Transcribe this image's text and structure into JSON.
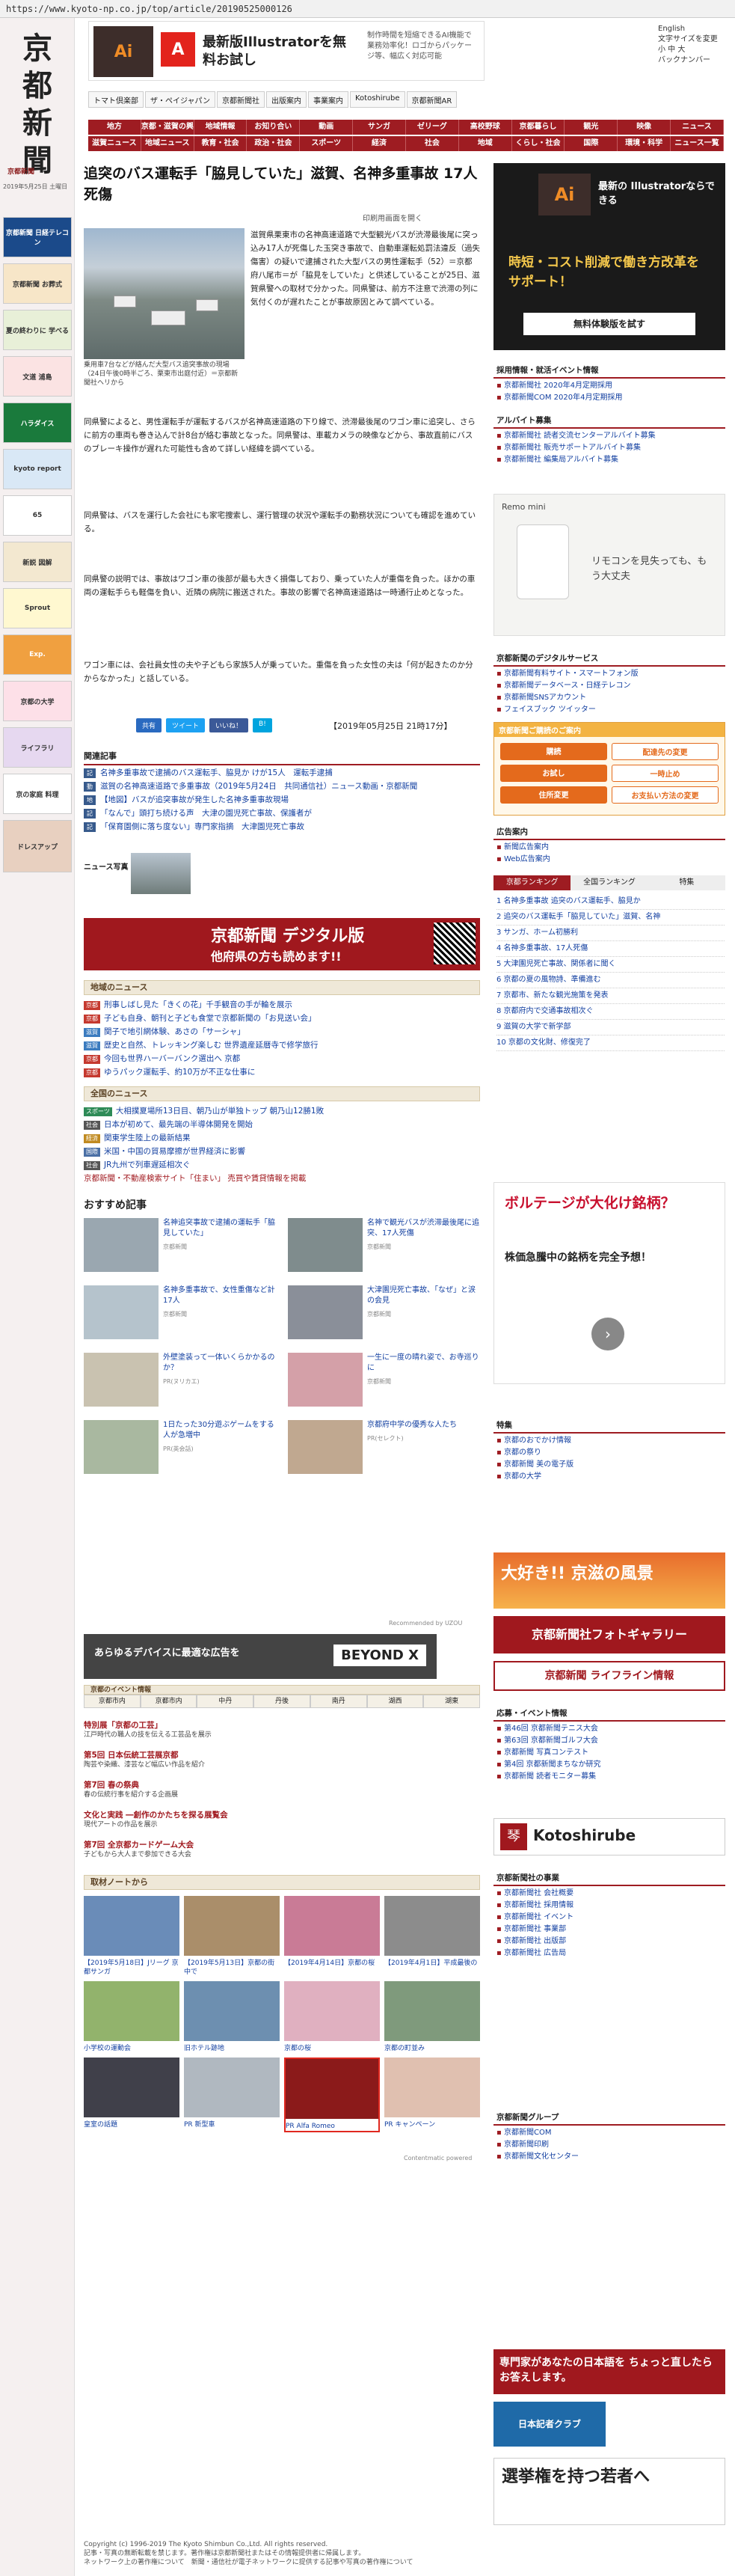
{
  "browser": {
    "url": "https://www.kyoto-np.co.jp/top/article/20190525000126"
  },
  "site": {
    "logo_lines": [
      "京",
      "都",
      "新",
      "聞"
    ],
    "name": "京都新聞",
    "date_text": "2019年5月25日 土曜日"
  },
  "left_banners": [
    "京都新聞 日経テレコン",
    "京都新聞 お葬式",
    "夏の終わりに 学べる",
    "文道 浦島",
    "ハラダイス",
    "kyoto report",
    "65",
    "新説 図解",
    "Sprout",
    "Exp.",
    "京都の大学",
    "ライフラリ",
    "京の家庭 料理",
    "ドレスアップ"
  ],
  "top_ad": {
    "left_label": "Ai",
    "adobe": "A",
    "headline": "最新版Illustratorを無料お試し",
    "body": "制作時間を短縮できるAI機能で業務効率化！ロゴからパッケージ等、幅広く対応可能"
  },
  "english": {
    "line1": "English",
    "line2": "文字サイズを変更",
    "line3": "小 中 大",
    "line4": "バックナンバー"
  },
  "toolbar": [
    "トマト倶楽部",
    "ザ・ペイジャパン",
    "京都新聞社",
    "出版案内",
    "事業案内",
    "Kotoshirube",
    "京都新聞AR"
  ],
  "nav1": [
    "地方",
    "京都・滋賀の興味",
    "地域情報",
    "お知り合い",
    "動画",
    "サンガ",
    "ゼリーグ",
    "高校野球",
    "京都暮らし",
    "観光",
    "映像",
    "ニュース"
  ],
  "nav2": [
    "滋賀ニュース",
    "地域ニュース",
    "教育・社会",
    "政治・社会",
    "スポーツ",
    "経済",
    "社会",
    "地域",
    "くらし・社会",
    "国際",
    "環境・科学",
    "ニュース一覧"
  ],
  "article": {
    "title": "追突のバス運転手「脇見していた」滋賀、名神多重事故 17人死傷",
    "meta": "印刷用画面を開く",
    "caption": "乗用車7台などが絡んだ大型バス追突事故の現場（24日午後0時半ごろ、栗東市出庭付近）＝京都新聞社ヘリから",
    "p1": "滋賀県栗東市の名神高速道路で大型観光バスが渋滞最後尾に突っ込み17人が死傷した玉突き事故で、自動車運転処罰法違反（過失傷害）の疑いで逮捕された大型バスの男性運転手（52）＝京都府八尾市＝が「脇見をしていた」と供述していることが25日、滋賀県警への取材で分かった。同県警は、前方不注意で渋滞の列に気付くのが遅れたことが事故原因とみて調べている。",
    "p2": "同県警によると、男性運転手が運転するバスが名神高速道路の下り線で、渋滞最後尾のワゴン車に追突し、さらに前方の車両も巻き込んで計8台が絡む事故となった。同県警は、車載カメラの映像などから、事故直前にバスのブレーキ操作が遅れた可能性も含めて詳しい経緯を調べている。",
    "p3": "同県警は、バスを運行した会社にも家宅捜索し、運行管理の状況や運転手の勤務状況についても確認を進めている。",
    "p4": "同県警の説明では、事故はワゴン車の後部が最も大きく損傷しており、乗っていた人が重傷を負った。ほかの車両の運転手らも軽傷を負い、近隣の病院に搬送された。事故の影響で名神高速道路は一時通行止めとなった。",
    "p5": "ワゴン車には、会社員女性の夫や子どもら家族5人が乗っていた。重傷を負った女性の夫は「何が起きたのか分からなかった」と話している。",
    "date": "【2019年05月25日 21時17分】"
  },
  "sns": [
    "共有",
    "ツイート",
    "いいね！",
    "B!"
  ],
  "related": {
    "heading": "関連記事",
    "items": [
      "名神多重事故で逮捕のバス運転手、脇見か けが15人　運転手逮捕",
      "滋賀の名神高速道路で多重事故（2019年5月24日　共同通信社）ニュース動画・京都新聞",
      "【地図】バスが追突事故が発生した名神多重事故現場",
      "「なんで」頭打ち続ける声　大津の園児死亡事故、保護者が",
      "「保育園側に落ち度ない」専門家指摘　大津園児死亡事故"
    ]
  },
  "news_photo_label": "ニュース写真",
  "digital_banner": {
    "title": "京都新聞 デジタル版",
    "subtitle": "他府県の方も読めます!!"
  },
  "local_news": {
    "heading": "地域のニュース",
    "items": [
      [
        "京都",
        "刑事しばし見た「きくの花」千手観音の手が輪を展示"
      ],
      [
        "京都",
        "子ども自身、朝刊と子ども食堂で京都新聞の「お見送い会」"
      ],
      [
        "滋賀",
        "関子で地引網体験、あさの「サーシャ」"
      ],
      [
        "滋賀",
        "歴史と自然、トレッキング楽しむ 世界遺産延暦寺で修学旅行"
      ],
      [
        "京都",
        "今回も世界ハーバーバンク選出へ 京都"
      ],
      [
        "京都",
        "ゆうパック運転手、約10万が不正な仕事に"
      ]
    ]
  },
  "national_news": {
    "heading": "全国のニュース",
    "items": [
      [
        "スポーツ",
        "大相撲夏場所13日目、朝乃山が単独トップ 朝乃山12勝1敗"
      ],
      [
        "社会",
        "日本が初めて、最先端の半導体開発を開始"
      ],
      [
        "経済",
        "関東学生陸上の最新結果"
      ],
      [
        "国際",
        "米国・中国の貿易摩擦が世界経済に影響"
      ],
      [
        "社会",
        "JR九州で列車遅延相次ぐ"
      ]
    ],
    "notice": "京都新聞・不動産検索サイト「住まい」 売買や賃貸情報を掲載"
  },
  "recommend": {
    "heading": "おすすめ記事",
    "items": [
      {
        "t": "名神追突事故で逮捕の運転手「脇見していた」",
        "src": "京都新聞"
      },
      {
        "t": "名神で観光バスが渋滞最後尾に追突、17人死傷",
        "src": "京都新聞"
      },
      {
        "t": "名神多重事故で、女性重傷など計17人",
        "src": "京都新聞"
      },
      {
        "t": "大津園児死亡事故、「なぜ」と涙の会見",
        "src": "京都新聞"
      },
      {
        "t": "外壁塗装って一体いくらかかるのか？",
        "src": "PR(ヌリカエ)"
      },
      {
        "t": "一生に一度の晴れ姿で、お寺巡りに",
        "src": "京都新聞"
      },
      {
        "t": "1日たった30分遊ぶゲームをする人が急増中",
        "src": "PR(英会話)"
      },
      {
        "t": "京都府中学の優秀な人たち",
        "src": "PR(セレクト)"
      }
    ],
    "credit": "Recommended by UZOU"
  },
  "ad2": {
    "left": "あらゆるデバイスに最適な広告を",
    "right": "BEYOND X"
  },
  "events": {
    "heading": "京都のイベント情報",
    "tabs": [
      "京都市内",
      "京都市内",
      "中丹",
      "丹後",
      "南丹",
      "湖西",
      "湖東"
    ],
    "items": [
      {
        "t": "特別展「京都の工芸」",
        "d": "江戸時代の職人の技を伝える工芸品を展示"
      },
      {
        "t": "第5回 日本伝統工芸展京都",
        "d": "陶芸や染織、漆芸など幅広い作品を紹介"
      },
      {
        "t": "第7回 春の祭典",
        "d": "春の伝統行事を紹介する企画展"
      },
      {
        "t": "文化と実践 ―創作のかたちを探る展覧会",
        "d": "現代アートの作品を展示"
      },
      {
        "t": "第7回 全京都カードゲーム大会",
        "d": "子どもから大人まで参加できる大会"
      }
    ]
  },
  "gallery": {
    "heading": "取材ノートから",
    "items": [
      {
        "t": "【2019年5月18日】Jリーグ 京都サンガ",
        "c": "#6a8cb8"
      },
      {
        "t": "【2019年5月13日】京都の街中で",
        "c": "#aa8e6a"
      },
      {
        "t": "【2019年4月14日】京都の桜",
        "c": "#c97b96"
      },
      {
        "t": "【2019年4月1日】平成最後の",
        "c": "#8c8c8c"
      },
      {
        "t": "小学校の運動会",
        "c": "#92b36c"
      },
      {
        "t": "旧ホテル跡地",
        "c": "#6d8fb0"
      },
      {
        "t": "京都の桜",
        "c": "#e0b0c0"
      },
      {
        "t": "京都の町並み",
        "c": "#7f9a7c"
      },
      {
        "t": "皇室の話題",
        "c": "#40404a"
      },
      {
        "t": "PR 新型車",
        "c": "#b0b8c0"
      },
      {
        "t": "PR Alfa Romeo",
        "c": "#8b1a1a"
      },
      {
        "t": "PR キャンペーン",
        "c": "#e0c0b0"
      }
    ],
    "credit": "Contentmatic powered"
  },
  "footer": {
    "copyright": "Copyright (c) 1996-2019 The Kyoto Shimbun Co.,Ltd. All rights reserved.",
    "line2": "記事・写真の無断転載を禁じます。著作権は京都新聞社またはその情報提供者に帰属します。",
    "line3": "ネットワーク上の著作権について　新聞・通信社が電子ネットワークに提供する記事や写真の著作権について"
  },
  "right": {
    "ad_top": {
      "title": "最新の Illustratorならできる",
      "sub": "時短・コスト削減で働き方改革をサポート！",
      "cta": "無料体験版を試す"
    },
    "jobs": {
      "heading": "採用情報・就活イベント情報",
      "items": [
        "京都新聞社 2020年4月定期採用",
        "京都新聞COM 2020年4月定期採用"
      ]
    },
    "part": {
      "heading": "アルバイト募集",
      "items": [
        "京都新聞社 読者交流センターアルバイト募集",
        "京都新聞社 販売サポートアルバイト募集",
        "京都新聞社 編集局アルバイト募集"
      ]
    },
    "remo": {
      "title": "Remo mini",
      "sub": "リモコンを見失っても、もう大丈夫"
    },
    "digital": {
      "heading": "京都新聞のデジタルサービス",
      "items": [
        "京都新聞有料サイト・スマートフォン版",
        "京都新聞データベース・日経テレコン",
        "京都新聞SNSアカウント",
        "フェイスブック ツイッター"
      ]
    },
    "subscribe": {
      "heading": "京都新聞ご購読のご案内",
      "items": [
        "購読",
        "お試し",
        "住所変更",
        "配達先の変更",
        "一時止め",
        "お支払い方法の変更"
      ]
    },
    "adguide": {
      "heading": "広告案内",
      "items": [
        "新聞広告案内",
        "Web広告案内"
      ]
    },
    "ranking": {
      "tabs": [
        "京都ランキング",
        "全国ランキング",
        "特集"
      ],
      "items": [
        "1 名神多重事故 追突のバス運転手、脇見か",
        "2 追突のバス運転手「脇見していた」滋賀、名神",
        "3 サンガ、ホーム初勝利",
        "4 名神多重事故、17人死傷",
        "5 大津園児死亡事故、関係者に聞く",
        "6 京都の夏の風物詩、準備進む",
        "7 京都市、新たな観光施策を発表",
        "8 京都府内で交通事故相次ぐ",
        "9 滋賀の大学で新学部",
        "10 京都の文化財、修復完了"
      ]
    },
    "polter": {
      "title": "ボルテージが大化け銘柄？",
      "sub": "株価急騰中の銘柄を完全予想！"
    },
    "features": {
      "heading": "特集",
      "items": [
        "京都のおでかけ情報",
        "京都の祭り",
        "京都新聞 美の電子版",
        "京都の大学"
      ]
    },
    "kyoto_banner": {
      "title": "大好き!! 京滋の風景",
      "sub": "京都新聞社フォトギャラリー"
    },
    "lifeline": "京都新聞 ライフライン情報",
    "events2": {
      "heading": "応募・イベント情報",
      "items": [
        "第46回 京都新聞テニス大会",
        "第63回 京都新聞ゴルフ大会",
        "京都新聞 写真コンテスト",
        "第4回 京都新聞まちなか研究",
        "京都新聞 読者モニター募集"
      ]
    },
    "kotoshirube": "Kotoshirube",
    "company": {
      "heading": "京都新聞社の事業",
      "items": [
        "京都新聞社 会社概要",
        "京都新聞社 採用情報",
        "京都新聞社 イベント",
        "京都新聞社 事業部",
        "京都新聞社 出版部",
        "京都新聞社 広告局"
      ]
    },
    "group": {
      "heading": "京都新聞グループ",
      "items": [
        "京都新聞COM",
        "京都新聞印刷",
        "京都新聞文化センター"
      ]
    },
    "bottom_ads": [
      "専門家があなたの日本語を ちょっと直したらお答えします。",
      "日本記者クラブ",
      "選挙権を持つ若者へ"
    ]
  }
}
